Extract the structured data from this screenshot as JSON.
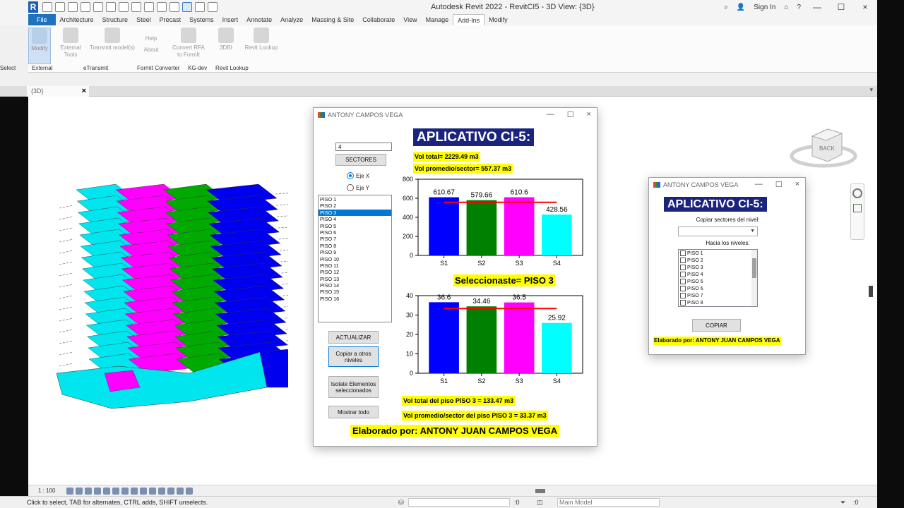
{
  "app": {
    "title": "Autodesk Revit 2022 - RevitCI5 - 3D View: {3D}",
    "sign_in": "Sign In",
    "logo": "R"
  },
  "ribbon": {
    "tabs": [
      "File",
      "Architecture",
      "Structure",
      "Steel",
      "Precast",
      "Systems",
      "Insert",
      "Annotate",
      "Analyze",
      "Massing & Site",
      "Collaborate",
      "View",
      "Manage",
      "Add-Ins",
      "Modify"
    ],
    "active_tab": "Add-Ins",
    "buttons": {
      "modify": "Modify",
      "external_tools": "External Tools",
      "transmit_models": "Transmit model(s)",
      "help": "Help",
      "about": "About",
      "convert_rfa": "Convert RFA to FormIt",
      "threedbi": "3DBI",
      "revit_lookup": "Revit Lookup"
    },
    "panels": {
      "select": "Select",
      "external": "External",
      "etransmit": "eTransmit",
      "formit": "FormIt Converter",
      "kgdev": "KG-dev",
      "revit_lookup": "Revit Lookup"
    }
  },
  "view_tab": {
    "label": "{3D}"
  },
  "view_control": {
    "scale": "1 : 100"
  },
  "status": {
    "message": "Click to select, TAB for alternates, CTRL adds, SHIFT unselects.",
    "workset_count": ":0",
    "model": "Main Model",
    "filter_count": ":0"
  },
  "dialog1": {
    "title": "ANTONY CAMPOS VEGA",
    "banner": "APLICATIVO CI-5:",
    "sectors_input": "4",
    "sectors_button": "SECTORES",
    "eje_x": "Eje X",
    "eje_y": "Eje Y",
    "floors": [
      "PISO 1",
      "PISO 2",
      "PISO 3",
      "PISO 4",
      "PISO 5",
      "PISO 6",
      "PISO 7",
      "PISO 8",
      "PISO 9",
      "PISO 10",
      "PISO 11",
      "PISO 12",
      "PISO 13",
      "PISO 14",
      "PISO 15",
      "PISO 16"
    ],
    "selected_floor": "PISO 3",
    "vol_total": "Vol total= 2229.49 m3",
    "vol_promedio": "Vol promedio/sector= 557.37 m3",
    "seleccionaste": "Seleccionaste= PISO 3",
    "vol_total_piso": "Vol total del piso PISO 3 = 133.47 m3",
    "vol_promedio_piso": "Vol promedio/sector del piso PISO 3 = 33.37 m3",
    "elaborado": "Elaborado por: ANTONY JUAN CAMPOS VEGA",
    "btn_actualizar": "ACTUALIZAR",
    "btn_copiar": "Copiar a otros niveles",
    "btn_isolate": "Isolate Elementos seleccionados",
    "btn_mostrar": "Mostrar todo"
  },
  "dialog2": {
    "title": "ANTONY CAMPOS VEGA",
    "banner": "APLICATIVO CI-5:",
    "copiar_label": "Copiar sectores del nivel:",
    "hacia_label": "Hacia los niveles:",
    "levels": [
      "PISO 1",
      "PISO 2",
      "PISO 3",
      "PISO 4",
      "PISO 5",
      "PISO 6",
      "PISO 7",
      "PISO 8"
    ],
    "btn_copiar": "COPIAR",
    "elaborado": "Elaborado por: ANTONY JUAN CAMPOS VEGA"
  },
  "chart_data": [
    {
      "type": "bar",
      "categories": [
        "S1",
        "S2",
        "S3",
        "S4"
      ],
      "values": [
        610.67,
        579.66,
        610.6,
        428.56
      ],
      "data_labels": [
        "610.67",
        "579.66",
        "610.6",
        "428.56"
      ],
      "colors": [
        "#0000ff",
        "#008000",
        "#ff00ff",
        "#00ffff"
      ],
      "average_line": 557.37,
      "average_color": "#ff0000",
      "ylim": [
        0,
        800
      ],
      "yticks": [
        0,
        200,
        400,
        600,
        800
      ],
      "grid": false
    },
    {
      "type": "bar",
      "categories": [
        "S1",
        "S2",
        "S3",
        "S4"
      ],
      "values": [
        36.6,
        34.46,
        36.5,
        25.92
      ],
      "data_labels": [
        "36.6",
        "34.46",
        "36.5",
        "25.92"
      ],
      "colors": [
        "#0000ff",
        "#008000",
        "#ff00ff",
        "#00ffff"
      ],
      "average_line": 33.37,
      "average_color": "#ff0000",
      "ylim": [
        0,
        40
      ],
      "yticks": [
        0,
        10,
        20,
        30,
        40
      ],
      "grid": false
    }
  ],
  "model_view": {
    "floor_count": 16,
    "colors": [
      "#00e5ee",
      "#ff00ff",
      "#00aa00",
      "#0000ee"
    ]
  },
  "icons": {
    "viewcube_face": "BACK",
    "close": "×",
    "minimize": "—",
    "maximize": "☐"
  }
}
